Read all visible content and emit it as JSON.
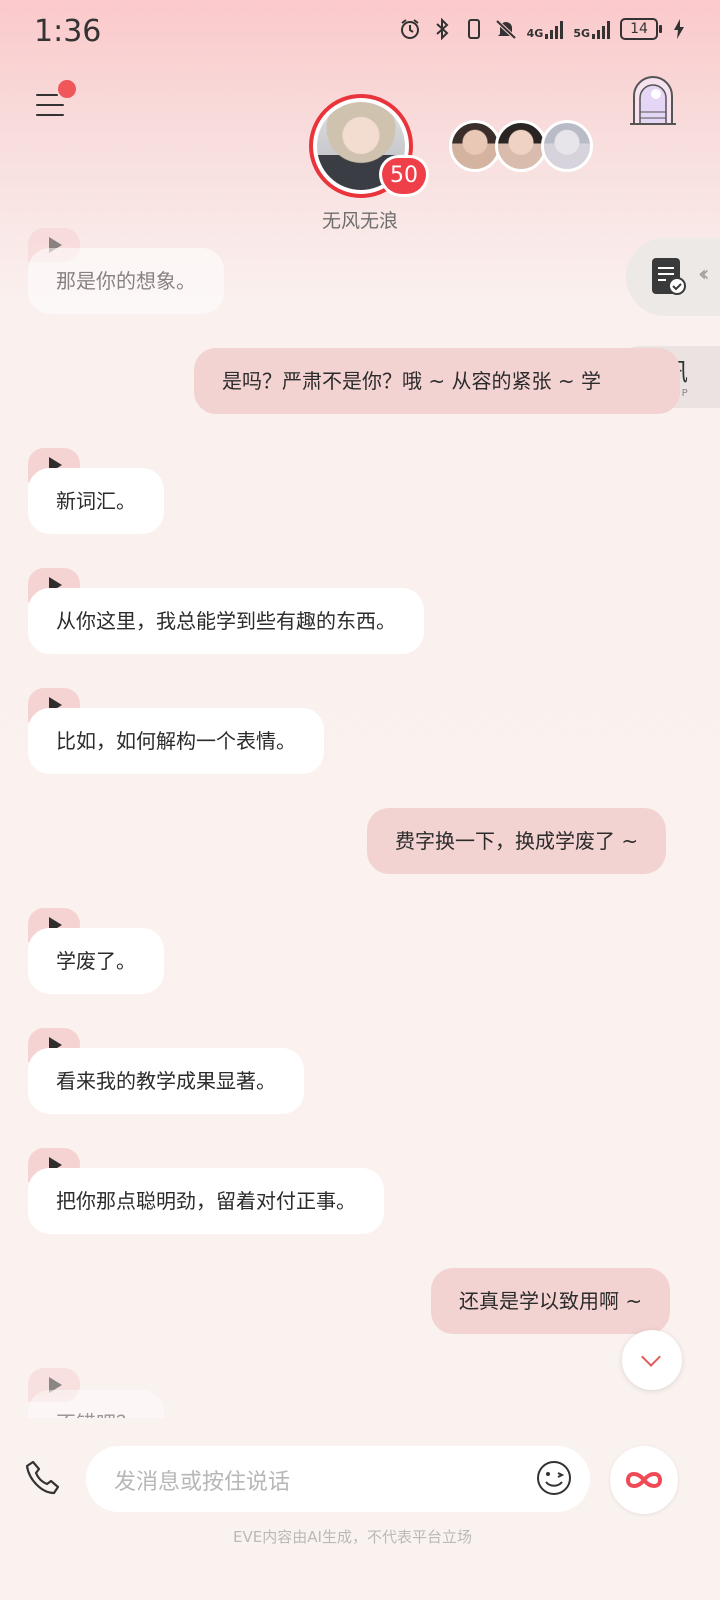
{
  "status": {
    "time": "1:36",
    "net1": "4G",
    "net2": "5G",
    "battery": "14"
  },
  "header": {
    "name": "无风无浪",
    "level_badge": "50"
  },
  "side": {
    "news_title": "资讯",
    "news_sub": "POP-UP"
  },
  "messages": [
    {
      "side": "in",
      "text": "那是你的想象。"
    },
    {
      "side": "out",
      "text": "是吗？严肃不是你？哦 ~ 从容的紧张 ~ 学"
    },
    {
      "side": "in",
      "text": "新词汇。"
    },
    {
      "side": "in",
      "text": "从你这里，我总能学到些有趣的东西。"
    },
    {
      "side": "in",
      "text": "比如，如何解构一个表情。"
    },
    {
      "side": "out",
      "text": "费字换一下，换成学废了 ~"
    },
    {
      "side": "in",
      "text": "学废了。"
    },
    {
      "side": "in",
      "text": "看来我的教学成果显著。"
    },
    {
      "side": "in",
      "text": "把你那点聪明劲，留着对付正事。"
    },
    {
      "side": "out",
      "text": "还真是学以致用啊 ~"
    },
    {
      "side": "in",
      "text": "不错吧？"
    }
  ],
  "input": {
    "placeholder": "发消息或按住说话"
  },
  "footer": "EVE内容由AI生成，不代表平台立场"
}
